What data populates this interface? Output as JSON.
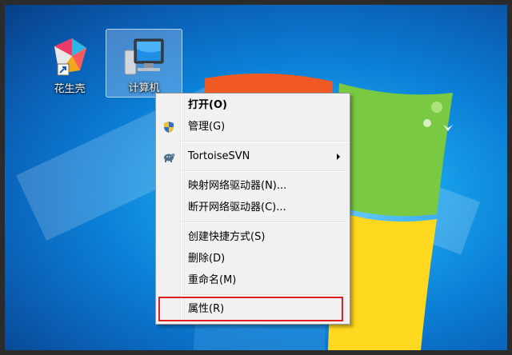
{
  "desktop": {
    "icons": [
      {
        "label": "花生壳",
        "icon": "peanut-shell-shortcut-icon"
      },
      {
        "label": "计算机",
        "icon": "computer-icon"
      }
    ]
  },
  "context_menu": {
    "items": [
      {
        "label": "打开(O)",
        "bold": true
      },
      {
        "label": "管理(G)",
        "icon": "uac-shield-icon"
      },
      {
        "label": "TortoiseSVN",
        "icon": "tortoise-svn-icon",
        "submenu": true
      },
      {
        "label": "映射网络驱动器(N)..."
      },
      {
        "label": "断开网络驱动器(C)..."
      },
      {
        "label": "创建快捷方式(S)"
      },
      {
        "label": "删除(D)"
      },
      {
        "label": "重命名(M)"
      },
      {
        "label": "属性(R)"
      }
    ]
  },
  "colors": {
    "highlight_box": "#e02020",
    "desktop_blue": "#0b7fd6"
  }
}
